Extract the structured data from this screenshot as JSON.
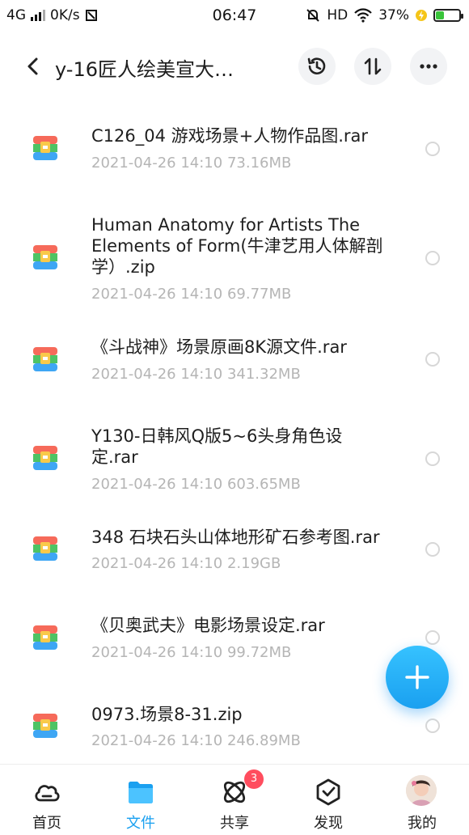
{
  "status_bar": {
    "network": "4G",
    "speed": "0K/s",
    "time": "06:47",
    "hd": "HD",
    "battery": "37%",
    "battery_level": 0.37
  },
  "header": {
    "title": "y-16匠人绘美宣大…"
  },
  "files": [
    {
      "name": "C126_04 游戏场景+人物作品图.rar",
      "date": "2021-04-26  14:10",
      "size": "73.16MB"
    },
    {
      "name": "Human Anatomy for Artists The Elements of Form(牛津艺用人体解剖学）.zip",
      "date": "2021-04-26  14:10",
      "size": "69.77MB"
    },
    {
      "name": "《斗战神》场景原画8K源文件.rar",
      "date": "2021-04-26  14:10",
      "size": "341.32MB"
    },
    {
      "name": "Y130-日韩风Q版5~6头身角色设定.rar",
      "date": "2021-04-26  14:10",
      "size": "603.65MB"
    },
    {
      "name": "348 石块石头山体地形矿石参考图.rar",
      "date": "2021-04-26  14:10",
      "size": "2.19GB"
    },
    {
      "name": "《贝奥武夫》电影场景设定.rar",
      "date": "2021-04-26  14:10",
      "size": "99.72MB"
    },
    {
      "name": "0973.场景8-31.zip",
      "date": "2021-04-26  14:10",
      "size": "246.89MB"
    }
  ],
  "nav": {
    "home": "首页",
    "files": "文件",
    "share": "共享",
    "share_badge": "3",
    "discover": "发现",
    "me": "我的"
  },
  "colors": {
    "accent": "#1aa0f0",
    "badge": "#ff4d5e"
  }
}
